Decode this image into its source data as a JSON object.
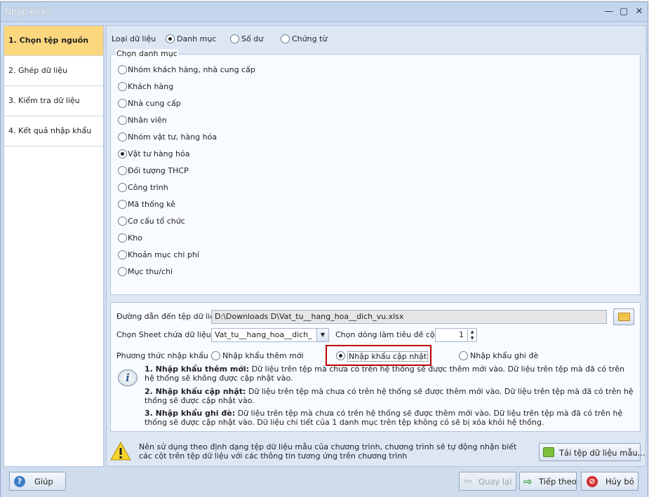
{
  "window": {
    "title": "Nhập khẩu"
  },
  "sidebar": {
    "steps": [
      {
        "label": "1. Chọn tệp nguồn"
      },
      {
        "label": "2. Ghép dữ liệu"
      },
      {
        "label": "3. Kiểm tra dữ liệu"
      },
      {
        "label": "4. Kết quả nhập khẩu"
      }
    ]
  },
  "data_type": {
    "label": "Loại dữ liệu",
    "options": [
      "Danh mục",
      "Số dư",
      "Chứng từ"
    ],
    "selected": "Danh mục"
  },
  "catalog": {
    "legend": "Chọn danh mục",
    "items": [
      "Nhóm khách hàng, nhà cung cấp",
      "Khách hàng",
      "Nhà cung cấp",
      "Nhân viên",
      "Nhóm vật tư, hàng hóa",
      "Vật tư hàng hóa",
      "Đối tượng THCP",
      "Công trình",
      "Mã thống kê",
      "Cơ cấu tổ chức",
      "Kho",
      "Khoản mục chi phí",
      "Mục thu/chi"
    ],
    "selected": "Vật tư hàng hóa"
  },
  "file": {
    "path_label": "Đường dẫn đến tệp dữ liệu",
    "path_value": "D:\\Downloads D\\Vat_tu__hang_hoa__dich_vu.xlsx",
    "sheet_label": "Chọn Sheet chứa dữ liệu",
    "sheet_value": "Vat_tu__hang_hoa__dich_",
    "header_row_label": "Chọn dòng làm tiêu đề cột",
    "header_row_value": "1"
  },
  "import_method": {
    "label": "Phương thức nhập khẩu",
    "options": [
      "Nhập khẩu thêm mới",
      "Nhập khẩu cập nhật",
      "Nhập khẩu ghi đè"
    ],
    "selected": "Nhập khẩu cập nhật",
    "desc1_title": "1. Nhập khẩu thêm mới:",
    "desc1_text": " Dữ liệu trên tệp mà chưa có trên hệ thống sẽ được thêm mới vào. Dữ liệu trên tệp mà đã có trên hệ thống sẽ không được cập nhật vào.",
    "desc2_title": "2. Nhập khẩu cập nhật:",
    "desc2_text": " Dữ liệu trên tệp mà chưa có trên hệ thống sẽ được thêm mới vào. Dữ liệu trên tệp mà đã có trên hệ thống sẽ được cập nhật vào.",
    "desc3_title": "3. Nhập khẩu ghi đè:",
    "desc3_text": " Dữ liệu trên tệp mà chưa có trên hệ thống sẽ được thêm mới vào. Dữ liệu trên tệp mà đã có trên hệ thống sẽ được cập nhật vào. Dữ liệu chi tiết của 1 danh mục trên tệp không có sẽ bị xóa khỏi hệ thống."
  },
  "notice": {
    "text": "Nên sử dụng theo định dạng tệp dữ liệu mẫu của chương trình, chương trình sẽ tự động nhận biết các cột trên tệp dữ liệu với các thông tin tương ứng trên chương trình",
    "download_button": "Tải tệp dữ liệu mẫu..."
  },
  "footer": {
    "help": "Giúp",
    "back": "Quay lại",
    "next": "Tiếp theo",
    "cancel": "Hủy bỏ"
  },
  "colors": {
    "active_step": "#fbd77e",
    "highlight_border": "#c00000"
  }
}
